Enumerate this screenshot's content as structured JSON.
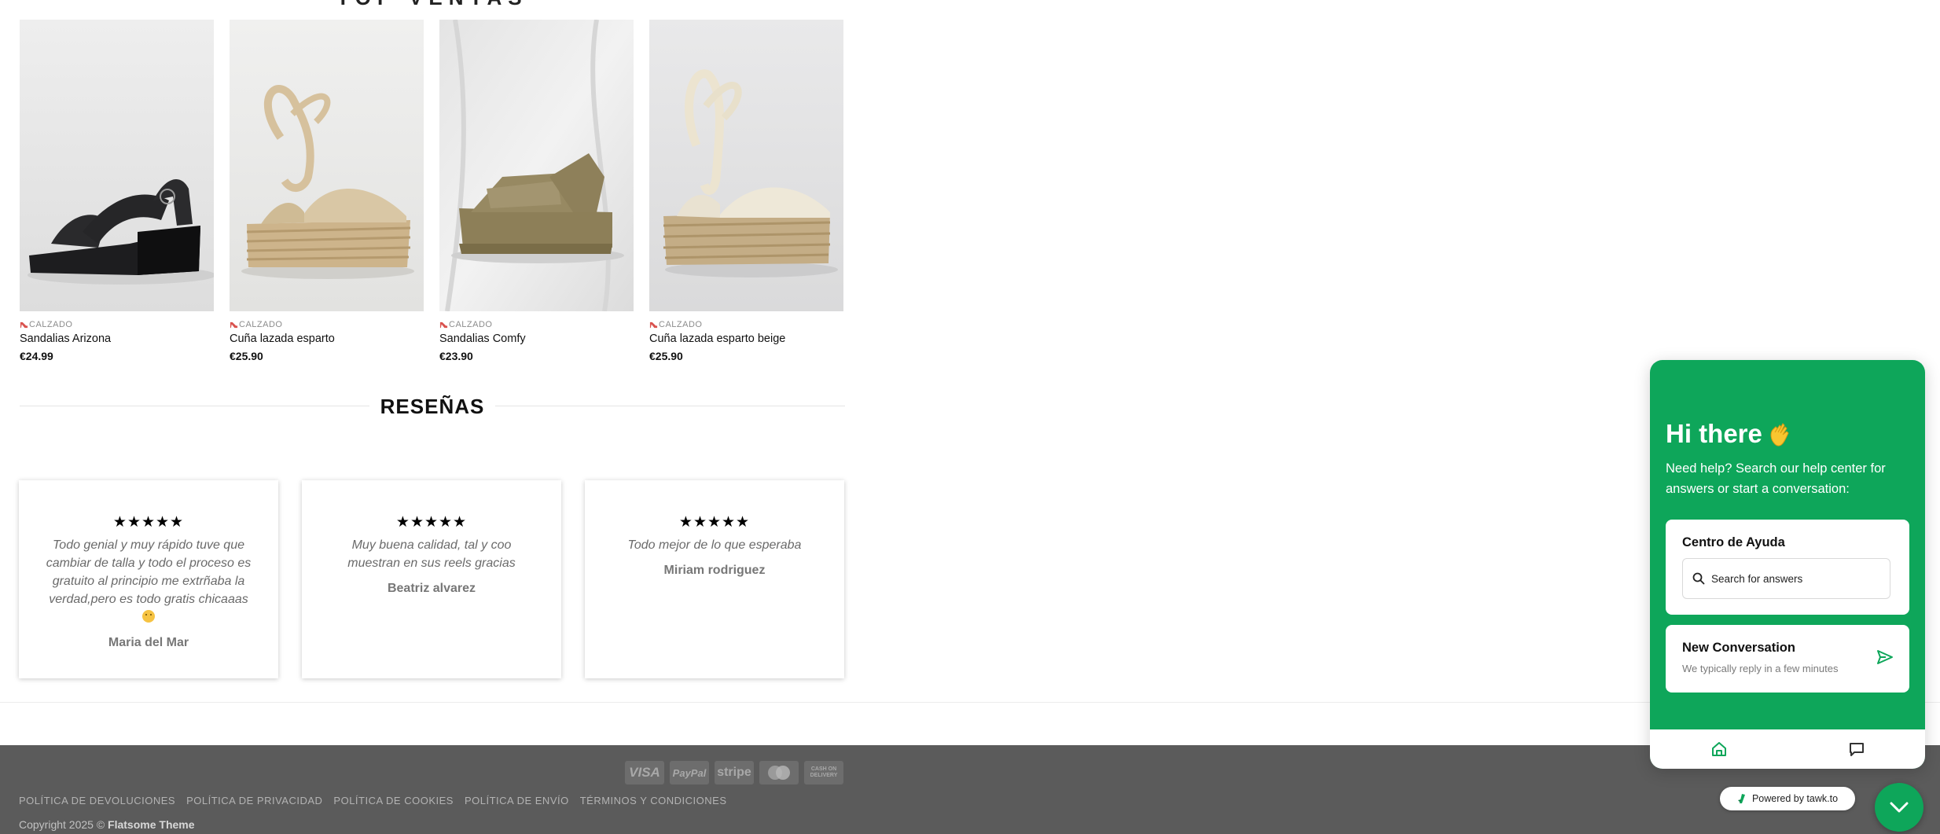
{
  "section": {
    "top_title": "TOP VENTAS"
  },
  "products": [
    {
      "category": "CALZADO",
      "name": "Sandalias Arizona",
      "price": "€24.99"
    },
    {
      "category": "CALZADO",
      "name": "Cuña lazada esparto",
      "price": "€25.90"
    },
    {
      "category": "CALZADO",
      "name": "Sandalias Comfy",
      "price": "€23.90"
    },
    {
      "category": "CALZADO",
      "name": "Cuña lazada esparto beige",
      "price": "€25.90"
    }
  ],
  "reviews_heading": "RESEÑAS",
  "reviews": [
    {
      "stars": "★★★★★",
      "rating": 5,
      "text": "Todo genial y muy rápido tuve que cambiar de talla y todo el proceso es gratuito al principio me extrñaba la verdad,pero es todo gratis chicaaas",
      "emoji": "slightly-smiling-face-icon",
      "author": "Maria del Mar"
    },
    {
      "stars": "★★★★★",
      "rating": 5,
      "text": "Muy buena calidad, tal y coo muestran en sus reels  gracias",
      "author": "Beatriz alvarez"
    },
    {
      "stars": "★★★★★",
      "rating": 5,
      "text": "Todo mejor de lo que esperaba",
      "author": "Miriam rodriguez"
    }
  ],
  "footer": {
    "payments": [
      "VISA",
      "PayPal",
      "stripe",
      "mastercard",
      "CASH ON DELIVERY"
    ],
    "links": [
      "POLÍTICA DE DEVOLUCIONES",
      "POLÍTICA DE PRIVACIDAD",
      "POLÍTICA DE COOKIES",
      "POLÍTICA DE ENVÍO",
      "TÉRMINOS Y CONDICIONES"
    ],
    "copyright_prefix": "Copyright 2025 © ",
    "copyright_brand": "Flatsome Theme"
  },
  "chat": {
    "greeting": "Hi there",
    "greeting_icon": "waving-hand-icon",
    "subtitle": "Need help? Search our help center for answers or start a conversation:",
    "help_title": "Centro de Ayuda",
    "search_placeholder": "Search for answers",
    "conv_title": "New Conversation",
    "conv_note": "We typically reply in a few minutes",
    "powered": "Powered by tawk.to"
  },
  "colors": {
    "chat_green": "#0ea65a",
    "footer_bg": "#5b5b5b",
    "heel_icon": "#d9534f"
  }
}
